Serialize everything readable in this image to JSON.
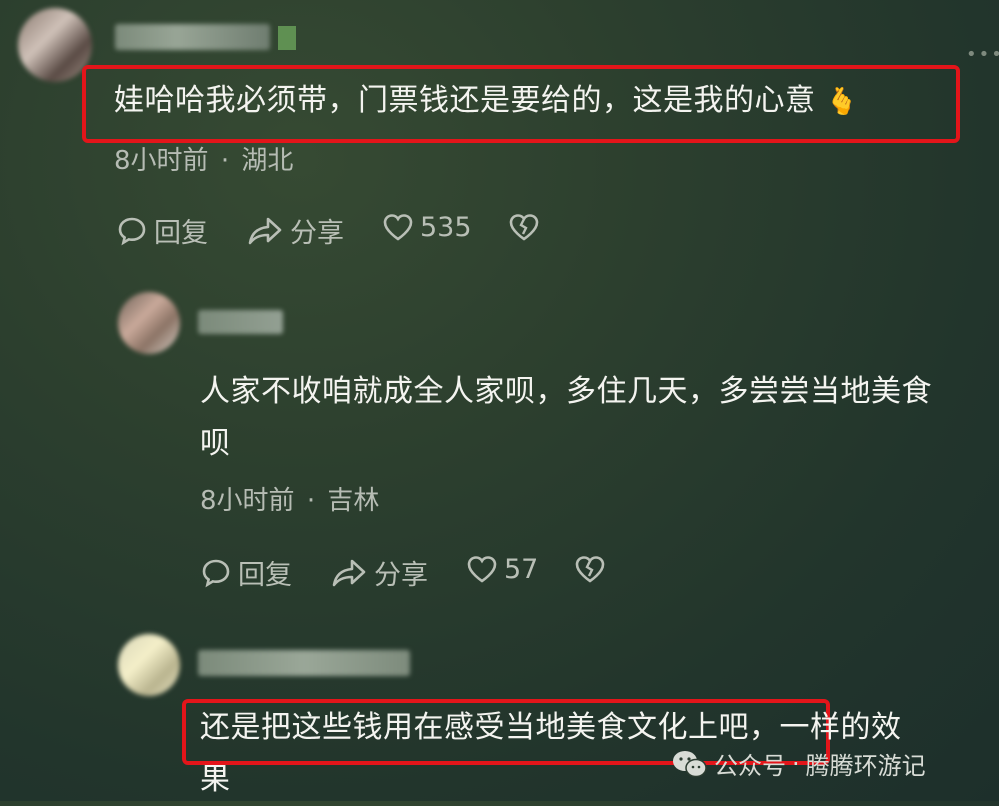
{
  "comments": [
    {
      "text": "娃哈哈我必须带，门票钱还是要给的，这是我的心意",
      "emoji": "🫰",
      "time": "8小时前",
      "location": "湖北",
      "reply_label": "回复",
      "share_label": "分享",
      "likes": "535"
    },
    {
      "text_line1": "人家不收咱就成全人家呗，多住几天，多尝尝当地美食",
      "text_line2": "呗",
      "time": "8小时前",
      "location": "吉林",
      "reply_label": "回复",
      "share_label": "分享",
      "likes": "57"
    },
    {
      "text_highlight": "还是把这些钱用在感受当地美食文化上吧，",
      "text_rest": "一样的效",
      "text_line2": "果"
    }
  ],
  "meta_separator": "·",
  "watermark": {
    "prefix": "公众号",
    "separator": "·",
    "name": "腾腾环游记"
  },
  "colors": {
    "highlight_border": "#e3151a",
    "text": "#f4f4f0",
    "meta": "#b6bcb4"
  }
}
